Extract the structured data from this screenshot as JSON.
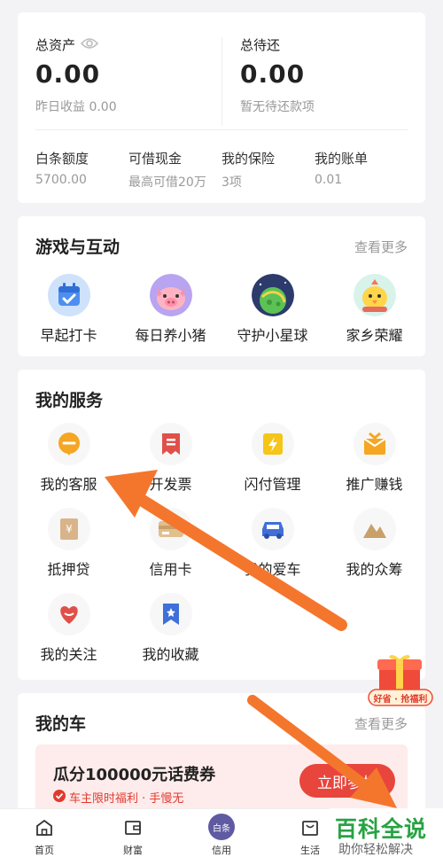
{
  "assets": {
    "total_label": "总资产",
    "total_value": "0.00",
    "yesterday_label": "昨日收益 0.00",
    "pending_label": "总待还",
    "pending_value": "0.00",
    "pending_sub": "暂无待还款项",
    "stats": [
      {
        "title": "白条额度",
        "value": "5700.00"
      },
      {
        "title": "可借现金",
        "value": "最高可借20万"
      },
      {
        "title": "我的保险",
        "value": "3项"
      },
      {
        "title": "我的账单",
        "value": "0.01"
      }
    ]
  },
  "games": {
    "title": "游戏与互动",
    "more": "查看更多",
    "items": [
      {
        "label": "早起打卡",
        "icon": "calendar-check-icon"
      },
      {
        "label": "每日养小猪",
        "icon": "pig-icon"
      },
      {
        "label": "守护小星球",
        "icon": "planet-icon"
      },
      {
        "label": "家乡荣耀",
        "icon": "chick-icon"
      }
    ]
  },
  "services": {
    "title": "我的服务",
    "items": [
      {
        "label": "我的客服",
        "icon": "customer-service-icon"
      },
      {
        "label": "开发票",
        "icon": "invoice-icon"
      },
      {
        "label": "闪付管理",
        "icon": "quick-pay-icon"
      },
      {
        "label": "推广赚钱",
        "icon": "promote-icon"
      },
      {
        "label": "抵押贷",
        "icon": "mortgage-icon"
      },
      {
        "label": "信用卡",
        "icon": "credit-card-icon"
      },
      {
        "label": "我的爱车",
        "icon": "car-icon"
      },
      {
        "label": "我的众筹",
        "icon": "crowdfunding-icon"
      },
      {
        "label": "我的关注",
        "icon": "heart-icon"
      },
      {
        "label": "我的收藏",
        "icon": "bookmark-icon"
      }
    ]
  },
  "car": {
    "title": "我的车",
    "more": "查看更多",
    "promo_title": "瓜分100000元话费券",
    "promo_sub": "车主限时福利 · 手慢无",
    "promo_button": "立即参加"
  },
  "gift_badge": "好省 · 抢福利",
  "tabbar": {
    "items": [
      {
        "label": "首页",
        "icon": "home-icon"
      },
      {
        "label": "财富",
        "icon": "wallet-icon"
      },
      {
        "label": "信用",
        "icon": "baitiao-icon",
        "badge": "白条"
      },
      {
        "label": "生活",
        "icon": "bag-icon"
      }
    ]
  },
  "watermark": {
    "title": "百科全说",
    "subtitle": "助你轻松解决"
  },
  "colors": {
    "accent_red": "#e8453c",
    "arrow": "#f4762d",
    "watermark_green": "#27a343"
  }
}
